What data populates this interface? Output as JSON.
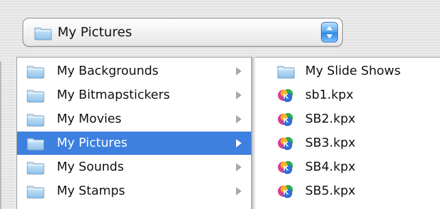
{
  "popup": {
    "label": "My Pictures"
  },
  "column1": {
    "items": [
      {
        "label": "My Backgrounds",
        "icon": "folder-icon",
        "selected": false
      },
      {
        "label": "My Bitmapstickers",
        "icon": "folder-icon",
        "selected": false
      },
      {
        "label": "My Movies",
        "icon": "folder-icon",
        "selected": false
      },
      {
        "label": "My Pictures",
        "icon": "folder-icon",
        "selected": true
      },
      {
        "label": "My Sounds",
        "icon": "folder-icon",
        "selected": false
      },
      {
        "label": "My Stamps",
        "icon": "folder-icon",
        "selected": false
      }
    ]
  },
  "column2": {
    "items": [
      {
        "label": "My Slide Shows",
        "icon": "folder-icon"
      },
      {
        "label": "sb1.kpx",
        "icon": "kpx-file-icon"
      },
      {
        "label": "SB2.kpx",
        "icon": "kpx-file-icon"
      },
      {
        "label": "SB3.kpx",
        "icon": "kpx-file-icon"
      },
      {
        "label": "SB4.kpx",
        "icon": "kpx-file-icon"
      },
      {
        "label": "SB5.kpx",
        "icon": "kpx-file-icon"
      }
    ]
  },
  "colors": {
    "selection": "#3d80df",
    "folder": "#9ec9ee"
  }
}
